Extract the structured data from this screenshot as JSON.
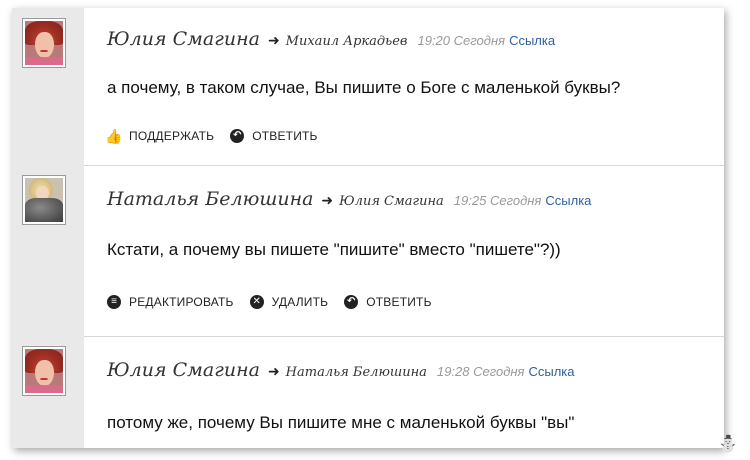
{
  "comments": [
    {
      "author": "Юлия Смагина",
      "reply_to": "Михаил Аркадьев",
      "time": "19:20",
      "day": "Сегодня",
      "link": "Ссылка",
      "text": "а почему, в таком случае, Вы пишите о Боге с маленькой буквы?",
      "actions": [
        "ПОДДЕРЖАТЬ",
        "ОТВЕТИТЬ"
      ]
    },
    {
      "author": "Наталья Белюшина",
      "reply_to": "Юлия Смагина",
      "time": "19:25",
      "day": "Сегодня",
      "link": "Ссылка",
      "text": "Кстати, а почему вы пишете \"пишите\" вместо \"пишете\"?))",
      "actions": [
        "РЕДАКТИРОВАТЬ",
        "УДАЛИТЬ",
        "ОТВЕТИТЬ"
      ]
    },
    {
      "author": "Юлия Смагина",
      "reply_to": "Наталья Белюшина",
      "time": "19:28",
      "day": "Сегодня",
      "link": "Ссылка",
      "text": "потому же, почему Вы пишите мне с маленькой буквы \"вы\""
    }
  ],
  "icons": {
    "arrow": "right-arrow-icon",
    "like": "thumbs-up-icon",
    "reply": "reply-icon",
    "edit": "edit-icon",
    "delete": "delete-icon"
  },
  "colors": {
    "link": "#2f5f9e",
    "time": "#999999",
    "sidebar": "#e9e9e9"
  }
}
